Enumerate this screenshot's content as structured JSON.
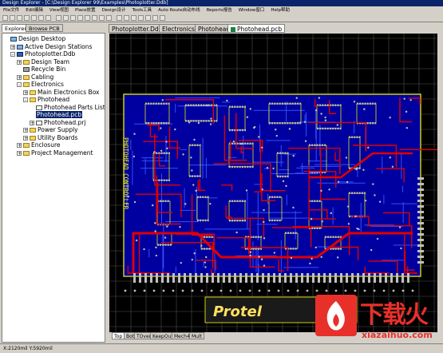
{
  "window": {
    "title": "Design Explorer - [C:\\Design Explorer 99\\Examples\\Photoplotter.Ddb]"
  },
  "menu": [
    "File文件",
    "Edit编辑",
    "View视图",
    "Place放置",
    "Design设计",
    "Tools工具",
    "Auto Route自动布线",
    "Reports报告",
    "Window窗口",
    "Help帮助"
  ],
  "panel_tabs": [
    "Explorer",
    "Browse PCB"
  ],
  "tree": [
    {
      "label": "Design Desktop",
      "icon": "pc",
      "level": 0,
      "exp": ""
    },
    {
      "label": "Active Design Stations",
      "icon": "pc",
      "level": 1,
      "exp": "+"
    },
    {
      "label": "Photoplotter.Ddb",
      "icon": "db",
      "level": 1,
      "exp": "-"
    },
    {
      "label": "Design Team",
      "icon": "folder",
      "level": 2,
      "exp": "+"
    },
    {
      "label": "Recycle Bin",
      "icon": "bin",
      "level": 2,
      "exp": ""
    },
    {
      "label": "Cabling",
      "icon": "folder",
      "level": 2,
      "exp": "+"
    },
    {
      "label": "Electronics",
      "icon": "folder",
      "level": 2,
      "exp": "-"
    },
    {
      "label": "Main Electronics Box",
      "icon": "folder",
      "level": 3,
      "exp": "+"
    },
    {
      "label": "Photohead",
      "icon": "folder",
      "level": 3,
      "exp": "-"
    },
    {
      "label": "Photohead Parts List",
      "icon": "doc",
      "level": 4,
      "exp": ""
    },
    {
      "label": "Photohead.pcb",
      "icon": "pcb",
      "level": 4,
      "exp": "",
      "selected": true
    },
    {
      "label": "Photohead.prj",
      "icon": "doc",
      "level": 4,
      "exp": "+"
    },
    {
      "label": "Power Supply",
      "icon": "folder",
      "level": 3,
      "exp": "+"
    },
    {
      "label": "Utility Boards",
      "icon": "folder",
      "level": 3,
      "exp": "+"
    },
    {
      "label": "Enclosure",
      "icon": "folder",
      "level": 2,
      "exp": "+"
    },
    {
      "label": "Project Management",
      "icon": "folder",
      "level": 2,
      "exp": "+"
    }
  ],
  "doc_tabs": [
    "Photoplotter.Ddb",
    "Electronics",
    "Photohead",
    "Photohead.pcb"
  ],
  "layer_tabs": [
    "Top",
    "Bot",
    "TOver",
    "KeepOut",
    "Mech4",
    "Mult"
  ],
  "pcb": {
    "silk_text": "PHOTOHEAD CONTROLLER",
    "logo": "Protel",
    "colors": {
      "board": "#0000a0",
      "top": "#e00000",
      "bottom": "#0000ff",
      "silk": "#ffff00",
      "pad": "#c0c0c0",
      "grid": "#505050"
    }
  },
  "status": "X:2120mil Y:5920mil",
  "watermark": {
    "title": "下载火",
    "url": "xiazaihuo.com"
  }
}
